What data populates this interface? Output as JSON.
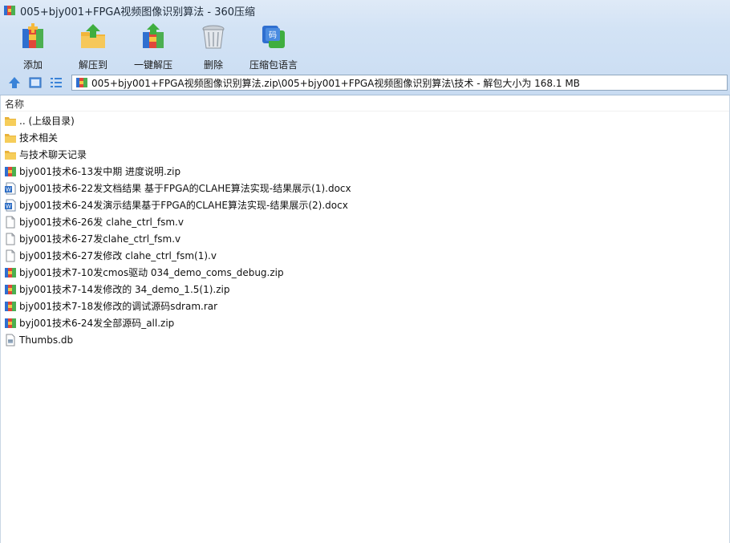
{
  "window": {
    "title": "005+bjy001+FPGA视频图像识别算法 - 360压缩"
  },
  "toolbar": {
    "items": [
      {
        "label": "添加",
        "icon": "add-archive-icon"
      },
      {
        "label": "解压到",
        "icon": "extract-to-icon"
      },
      {
        "label": "一键解压",
        "icon": "one-click-extract-icon"
      },
      {
        "label": "删除",
        "icon": "delete-bin-icon"
      },
      {
        "label": "压缩包语言",
        "icon": "archive-language-icon"
      }
    ]
  },
  "navigation": {
    "buttons": [
      {
        "icon": "up-arrow-icon"
      },
      {
        "icon": "thumbnail-view-icon"
      },
      {
        "icon": "list-view-icon"
      }
    ],
    "address": "005+bjy001+FPGA视频图像识别算法.zip\\005+bjy001+FPGA视频图像识别算法\\技术 - 解包大小为 168.1 MB"
  },
  "list": {
    "column_header": "名称",
    "items": [
      {
        "name": ".. (上级目录)",
        "type": "folder"
      },
      {
        "name": "技术相关",
        "type": "folder"
      },
      {
        "name": "与技术聊天记录",
        "type": "folder"
      },
      {
        "name": "bjy001技术6-13发中期 进度说明.zip",
        "type": "archive"
      },
      {
        "name": "bjy001技术6-22发文档结果 基于FPGA的CLAHE算法实现-结果展示(1).docx",
        "type": "word"
      },
      {
        "name": "bjy001技术6-24发演示结果基于FPGA的CLAHE算法实现-结果展示(2).docx",
        "type": "word"
      },
      {
        "name": "bjy001技术6-26发  clahe_ctrl_fsm.v",
        "type": "file"
      },
      {
        "name": "bjy001技术6-27发clahe_ctrl_fsm.v",
        "type": "file"
      },
      {
        "name": "bjy001技术6-27发修改 clahe_ctrl_fsm(1).v",
        "type": "file"
      },
      {
        "name": "bjy001技术7-10发cmos驱动  034_demo_coms_debug.zip",
        "type": "archive"
      },
      {
        "name": "bjy001技术7-14发修改的 34_demo_1.5(1).zip",
        "type": "archive"
      },
      {
        "name": "bjy001技术7-18发修改的调试源码sdram.rar",
        "type": "archive"
      },
      {
        "name": "byj001技术6-24发全部源码_all.zip",
        "type": "archive"
      },
      {
        "name": "Thumbs.db",
        "type": "db"
      }
    ]
  },
  "colors": {
    "chrome_top": "#dfeaf7",
    "chrome_bottom": "#c9dcf2",
    "folder": "#f2c94c",
    "archive_blue": "#2f6fd0",
    "archive_green": "#4caf50",
    "archive_red": "#e0483a"
  }
}
